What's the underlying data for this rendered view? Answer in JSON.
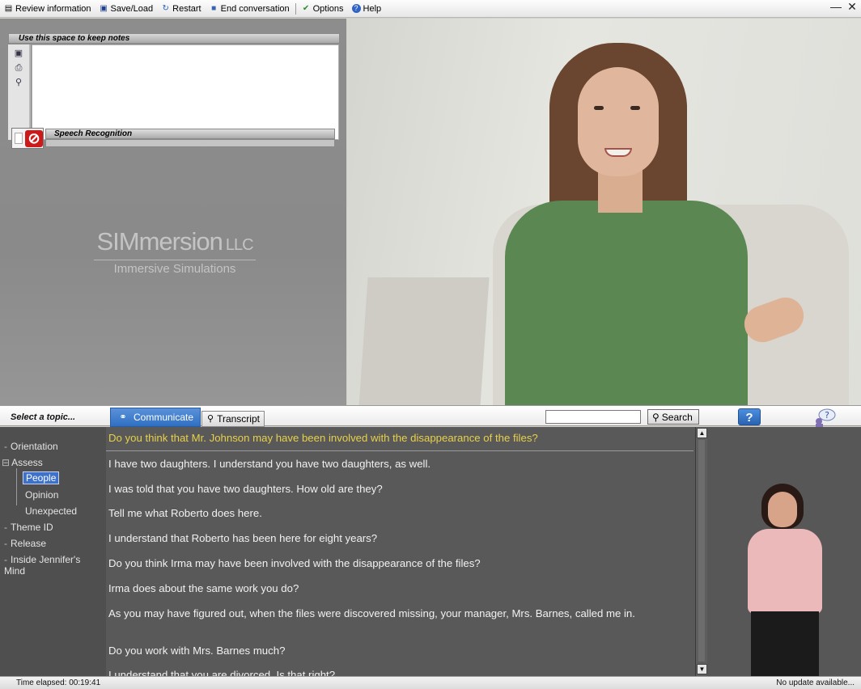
{
  "menu": {
    "items": [
      {
        "label": "Review information",
        "icon": "review-icon"
      },
      {
        "label": "Save/Load",
        "icon": "disk-icon"
      },
      {
        "label": "Restart",
        "icon": "restart-icon"
      },
      {
        "label": "End conversation",
        "icon": "stop-icon"
      },
      {
        "label": "Options",
        "icon": "check-icon"
      },
      {
        "label": "Help",
        "icon": "help-icon"
      }
    ]
  },
  "notes": {
    "header": "Use this space to keep notes",
    "value": ""
  },
  "speech": {
    "header": "Speech Recognition"
  },
  "logo": {
    "main": "SIMmersion",
    "suffix": "LLC",
    "tagline": "Immersive Simulations"
  },
  "tabs": {
    "topic_label": "Select a topic...",
    "communicate": "Communicate",
    "transcript": "Transcript",
    "search_button": "Search",
    "search_value": "",
    "help": "?"
  },
  "tree": {
    "items": [
      {
        "label": "Orientation",
        "glyph": "-"
      },
      {
        "label": "Assess",
        "glyph": "⊟"
      },
      {
        "label": "People",
        "glyph": ""
      },
      {
        "label": "Opinion",
        "glyph": ""
      },
      {
        "label": "Unexpected",
        "glyph": ""
      },
      {
        "label": "Theme ID",
        "glyph": "-"
      },
      {
        "label": "Release",
        "glyph": "-"
      },
      {
        "label": "Inside Jennifer's Mind",
        "glyph": "-"
      }
    ]
  },
  "questions": [
    "Do you think that Mr. Johnson may have been involved with the disappearance of the files?",
    "I have two daughters. I understand you have two daughters, as well.",
    "I was told that you have two daughters. How old are they?",
    "Tell me what Roberto does here.",
    "I understand that Roberto has been here for eight years?",
    "Do you think Irma may have been involved with the disappearance of the files?",
    "Irma does about the same work you do?",
    "As you may have figured out, when the files were discovered missing, your manager, Mrs. Barnes, called me in.",
    "Do you work with Mrs. Barnes much?",
    "I understand that you are divorced. Is that right?"
  ],
  "status": {
    "time_elapsed": "Time elapsed: 00:19:41",
    "update": "No update available..."
  },
  "colors": {
    "highlight_question": "#e8d04a",
    "tab_active": "#3a78c8",
    "selected_topic": "#3e71c9"
  }
}
